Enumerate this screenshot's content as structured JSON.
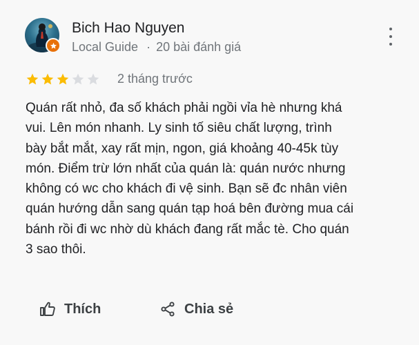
{
  "reviewer": {
    "name": "Bich Hao Nguyen",
    "level": "Local Guide",
    "separator": "·",
    "review_count": "20 bài đánh giá",
    "avatar_icon": "profile-photo",
    "badge_icon": "local-guide-star-icon",
    "badge_color": "#e8710a"
  },
  "menu": {
    "icon": "more-vert-icon"
  },
  "rating": {
    "value": 3,
    "max": 5,
    "filled_color": "#fbbc04",
    "empty_color": "#dadce0"
  },
  "time": "2 tháng trước",
  "review_lines": [
    "Quán rất nhỏ, đa số khách phải ngồi vỉa hè nhưng khá",
    "vui. Lên món nhanh. Ly sinh tố siêu chất lượng, trình",
    "bày bắt mắt, xay rất mịn, ngon, giá khoảng 40-45k tùy",
    "món. Điểm trừ lớn nhất của quán là: quán nước nhưng",
    "không có wc cho khách đi vệ sinh. Bạn sẽ đc nhân viên",
    "quán hướng dẫn sang quán tạp hoá bên đường mua cái",
    "bánh rồi đi wc nhờ dù khách đang rất mắc tè. Cho quán",
    "3 sao thôi."
  ],
  "actions": {
    "like_label": "Thích",
    "like_icon": "thumb-up-icon",
    "share_label": "Chia sẻ",
    "share_icon": "share-icon"
  }
}
